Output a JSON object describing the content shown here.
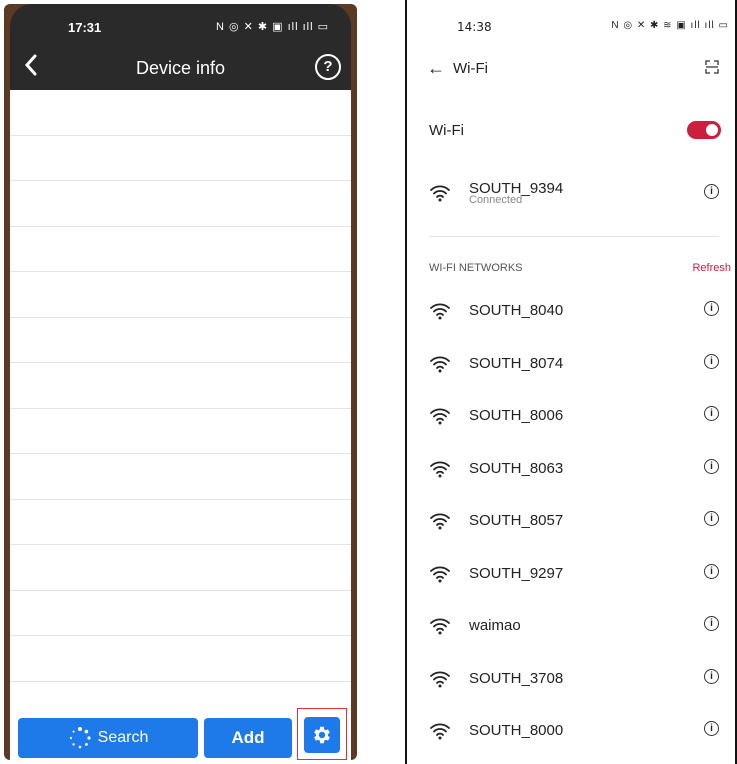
{
  "left": {
    "status_time": "17:31",
    "status_icons": "N ◎ ✕ ✱ ▣ ıll ıll ▭",
    "title": "Device info",
    "help": "?",
    "rows": 13,
    "buttons": {
      "search": "Search",
      "add": "Add"
    }
  },
  "right": {
    "status_time": "14:38",
    "status_icons": "N ◎ ✕ ✱ ≋ ▣ ıll ıll ▭",
    "title": "Wi-Fi",
    "wifi_label": "Wi-Fi",
    "toggle_on": true,
    "connected": {
      "ssid": "SOUTH_9394",
      "status": "Connected"
    },
    "section_label": "WI-FI NETWORKS",
    "refresh": "Refresh",
    "networks": [
      "SOUTH_8040",
      "SOUTH_8074",
      "SOUTH_8006",
      "SOUTH_8063",
      "SOUTH_8057",
      "SOUTH_9297",
      "waimao",
      "SOUTH_3708",
      "SOUTH_8000"
    ],
    "accent": "#c9203e"
  },
  "accent_blue": "#1e7ae8"
}
